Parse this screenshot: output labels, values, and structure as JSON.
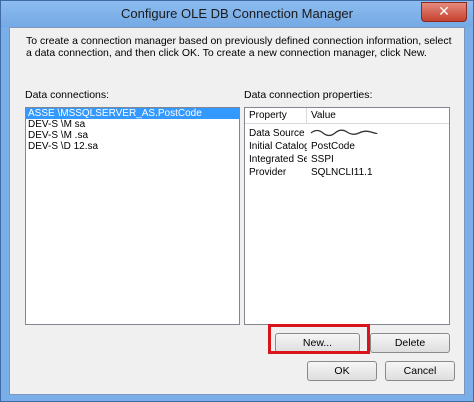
{
  "window": {
    "title": "Configure OLE DB Connection Manager",
    "close_glyph": "✕"
  },
  "instructions": "To create a connection manager based on previously defined connection information, select a data connection, and then click OK. To create a new connection manager, click New.",
  "data_connections": {
    "label": "Data connections:",
    "items": [
      {
        "label": "ASSE      \\MSSQLSERVER_AS.PostCode",
        "selected": true
      },
      {
        "label": "DEV-S      \\M                sa",
        "selected": false
      },
      {
        "label": "DEV-S      \\M            .sa",
        "selected": false
      },
      {
        "label": "DEV-S      \\D        12.sa",
        "selected": false
      }
    ]
  },
  "properties": {
    "label": "Data connection properties:",
    "header": {
      "property": "Property",
      "value": "Value"
    },
    "rows": [
      {
        "property": "Data Source",
        "value": ""
      },
      {
        "property": "Initial Catalog",
        "value": "PostCode"
      },
      {
        "property": "Integrated Se...",
        "value": "SSPI"
      },
      {
        "property": "Provider",
        "value": "SQLNCLI11.1"
      }
    ]
  },
  "buttons": {
    "new": "New...",
    "delete": "Delete",
    "ok": "OK",
    "cancel": "Cancel"
  },
  "colors": {
    "selection": "#3399ff",
    "highlight_box": "#d8151b",
    "window_frame": "#79aee8"
  }
}
